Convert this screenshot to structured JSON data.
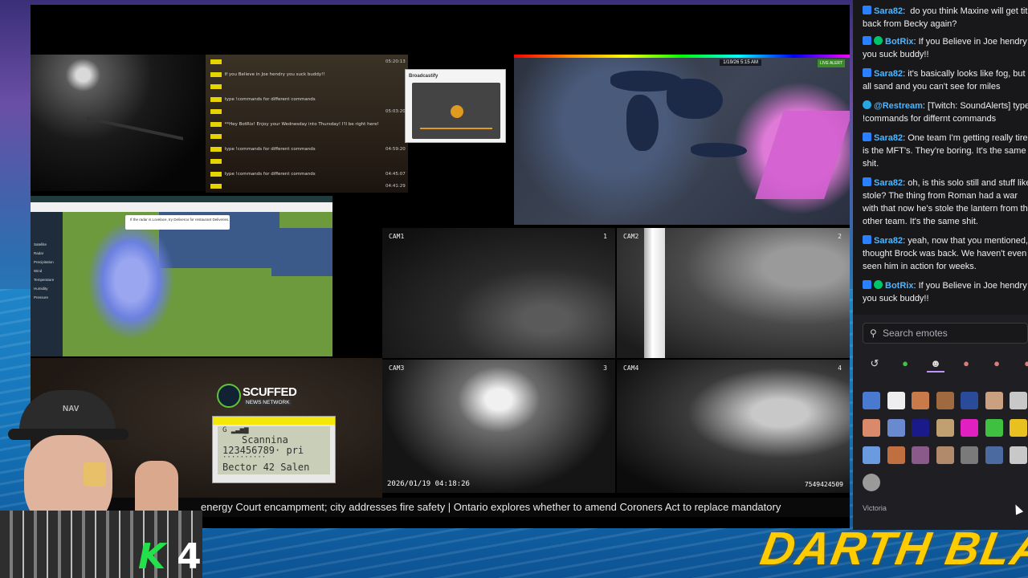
{
  "overlay": {
    "chatlog": [
      {
        "text": "",
        "time": "05:20:13"
      },
      {
        "text": "If you Believe in Joe hendry you suck buddy!!",
        "time": ""
      },
      {
        "text": "",
        "time": ""
      },
      {
        "text": "type !commands for different commands",
        "time": ""
      },
      {
        "text": "",
        "time": "05:03:20"
      },
      {
        "text": "**Hey BotRix! Enjoy your Wednesday into Thursday! I'll be right here!",
        "time": ""
      },
      {
        "text": "",
        "time": ""
      },
      {
        "text": "type !commands for different commands",
        "time": "04:59:20"
      },
      {
        "text": "",
        "time": ""
      },
      {
        "text": "type !commands for different commands",
        "time": "04:45:07"
      },
      {
        "text": "",
        "time": "04:41:29"
      }
    ],
    "popup_title": "Broadcastify",
    "weather_date": "1/19/26 5:15 AM",
    "weather_badge": "LIVE ALERT",
    "euro_ad": "If the radar is Lovelace, try Deliveroo for restaurant Deliveries.",
    "euro_layers": [
      "Satellite",
      "Radar",
      "Precipitation",
      "Wind",
      "Temperature",
      "Humidity",
      "Pressure"
    ],
    "cams": [
      {
        "label": "CAM1",
        "num": "1"
      },
      {
        "label": "CAM2",
        "num": "2"
      },
      {
        "label": "CAM3",
        "num": "3"
      },
      {
        "label": "CAM4",
        "num": "4"
      }
    ],
    "cam_timestamp": "2026/01/19 04:18:26",
    "cam_id": "7549424509",
    "news_logo": "SCUFFED",
    "news_sub": "NEWS NETWORK",
    "scanner_lines": [
      "G     ▂▃▅▆",
      "Scannina",
      "123456789· pri",
      "··········",
      "Bector 42 Salen"
    ],
    "ticker": "energy Court encampment; city addresses fire safety  |  Ontario explores whether to amend Coroners Act to replace mandatory",
    "k4_k": "K",
    "k4_num": "4",
    "darth": "DARTH BLAZE",
    "hat_text": "NAV"
  },
  "chat": {
    "messages": [
      {
        "user": "Sara82",
        "color": "#4fb6ff",
        "badge": "none",
        "text": ": ⁣⁣ do you think Maxine will get title back from Becky again? ⁣⁣"
      },
      {
        "user": "BotRix",
        "color": "#4fb6ff",
        "badge": "verified",
        "text": ": If you Believe in Joe hendry you suck buddy!!"
      },
      {
        "user": "Sara82",
        "color": "#4fb6ff",
        "badge": "none",
        "text": ": it's basically looks like fog, but all sand and you can't see for miles"
      },
      {
        "user": "@Restream",
        "color": "#4fb6ff",
        "badge": "restream",
        "text": ": [Twitch: SoundAlerts] type !commands for differnt commands"
      },
      {
        "user": "Sara82",
        "color": "#4fb6ff",
        "badge": "none",
        "text": ": One team I'm getting really tired is the MFT's. They're boring. It's the same shit."
      },
      {
        "user": "Sara82",
        "color": "#4fb6ff",
        "badge": "none",
        "text": ": oh, is this solo still and stuff like stole? The thing from Roman had a war with that now he's stole the lantern from the other team. It's the same shit."
      },
      {
        "user": "Sara82",
        "color": "#4fb6ff",
        "badge": "none",
        "text": ": yeah, now that you mentioned, I thought Brock was back. We haven't even seen him in action for weeks."
      },
      {
        "user": "BotRix",
        "color": "#4fb6ff",
        "badge": "verified",
        "text": ": If you Believe in Joe hendry you suck buddy!!"
      }
    ]
  },
  "emote_picker": {
    "search_placeholder": "Search emotes",
    "section_label": "Victoria",
    "tabs": [
      "recent-icon",
      "botrix-icon",
      "channel-1-icon",
      "channel-2-icon",
      "channel-3-icon",
      "channel-4-icon"
    ],
    "emote_colors": [
      "#4a7ad0",
      "#eeeeee",
      "#c87a4a",
      "#a06a40",
      "#2a4a9a",
      "#caa080",
      "#c8c8c8",
      "#d88a6a",
      "#6a8ad0",
      "#1a1a8a",
      "#c0a070",
      "#e020c0",
      "#40c040",
      "#e8c020",
      "#6a9ae0",
      "#c07040",
      "#8a5a8a",
      "#b08a6a",
      "#7a7a7a",
      "#4a6aa0",
      "#c8c8c8",
      "#9a9a9a"
    ]
  },
  "colors": {
    "chat_bg": "#18181b",
    "username": "#4fb6ff",
    "accent": "#bf94ff",
    "ticker_bg": "#0a0a0a",
    "darth": "#ffcc00",
    "k_green": "#22e14a"
  }
}
